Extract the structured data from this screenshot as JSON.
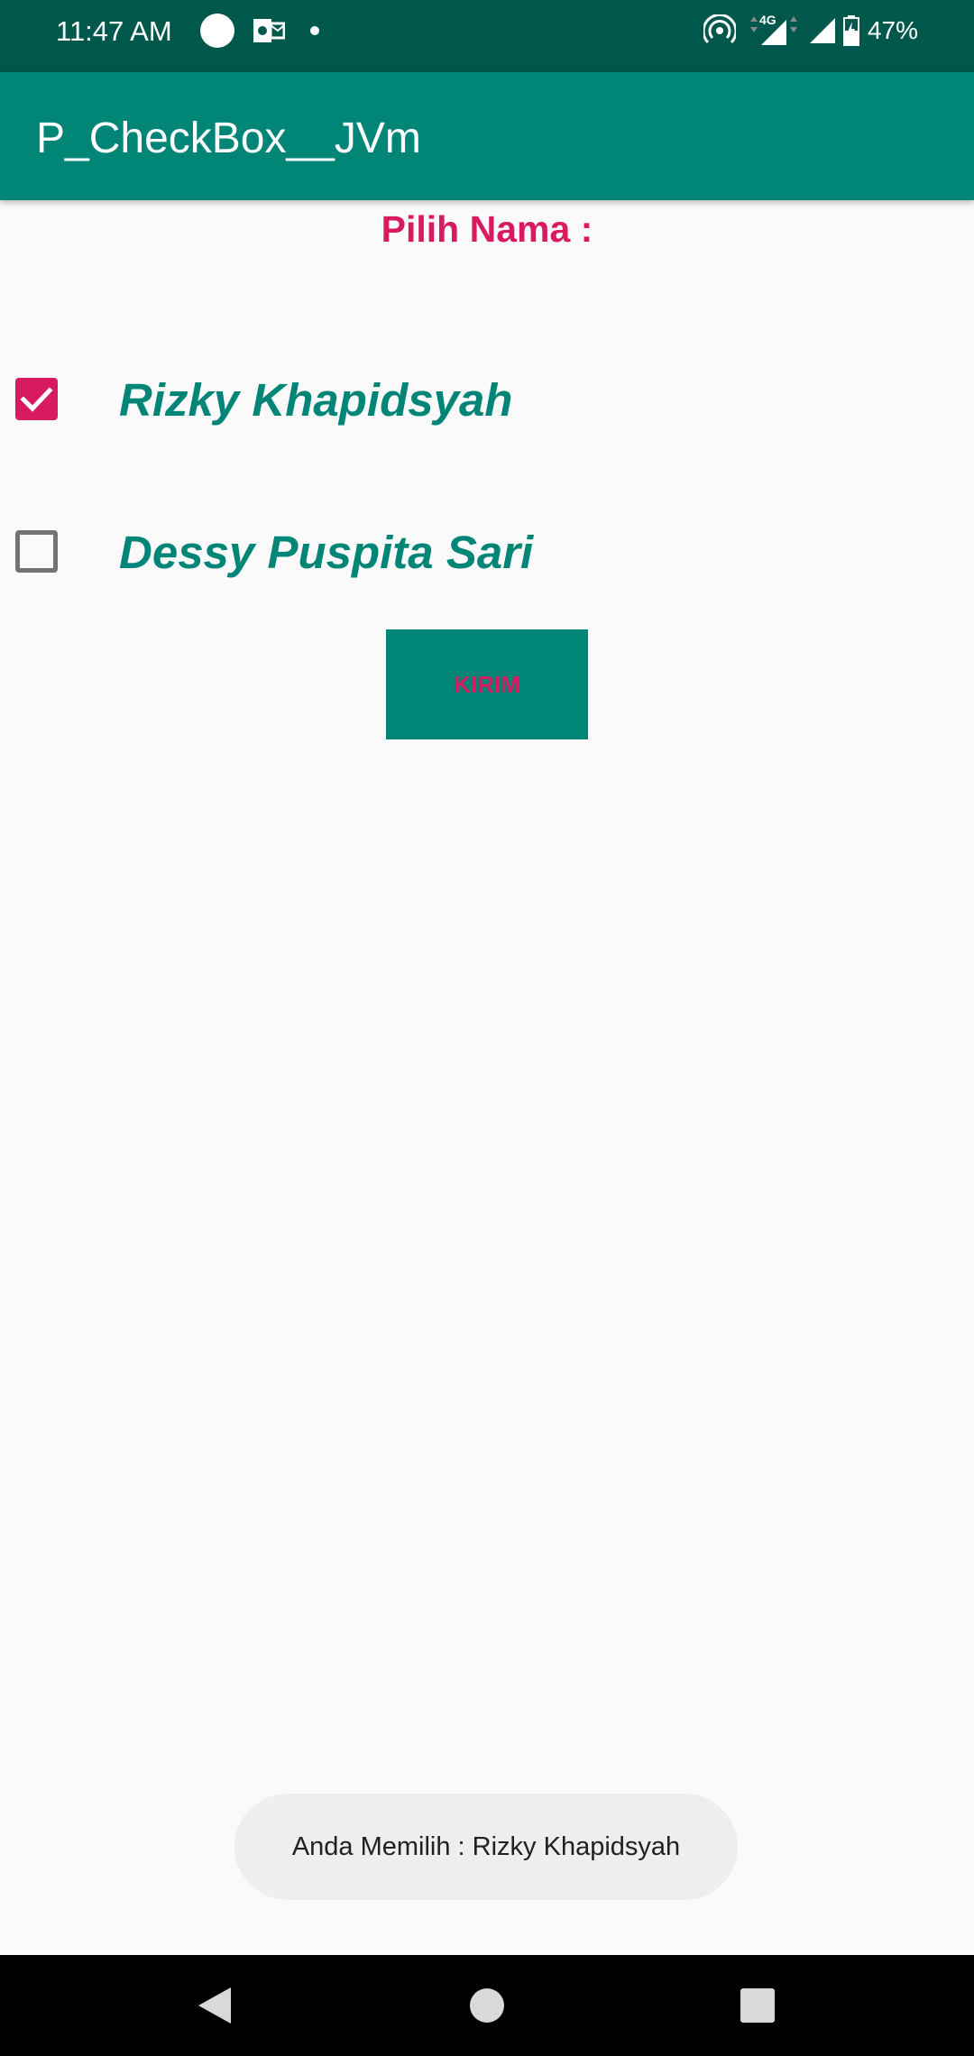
{
  "status_bar": {
    "time": "11:47 AM",
    "network": "4G",
    "battery": "47%",
    "icons_left": [
      "circle-icon",
      "outlook-icon",
      "dot-icon"
    ],
    "icons_right": [
      "hotspot-icon",
      "signal-4g-icon",
      "signal-icon",
      "battery-icon"
    ]
  },
  "app_bar": {
    "title": "P_CheckBox__JVm"
  },
  "prompt": "Pilih Nama :",
  "options": [
    {
      "label": "Rizky Khapidsyah",
      "checked": true
    },
    {
      "label": "Dessy Puspita Sari",
      "checked": false
    }
  ],
  "send_button": {
    "label": "KIRIM"
  },
  "toast": {
    "message": "Anda Memilih : Rizky Khapidsyah"
  },
  "nav_bar": [
    "back-icon",
    "home-icon",
    "recents-icon"
  ],
  "colors": {
    "primary": "#008577",
    "primary_dark": "#00574b",
    "accent": "#d81b60",
    "background": "#fafafa"
  }
}
